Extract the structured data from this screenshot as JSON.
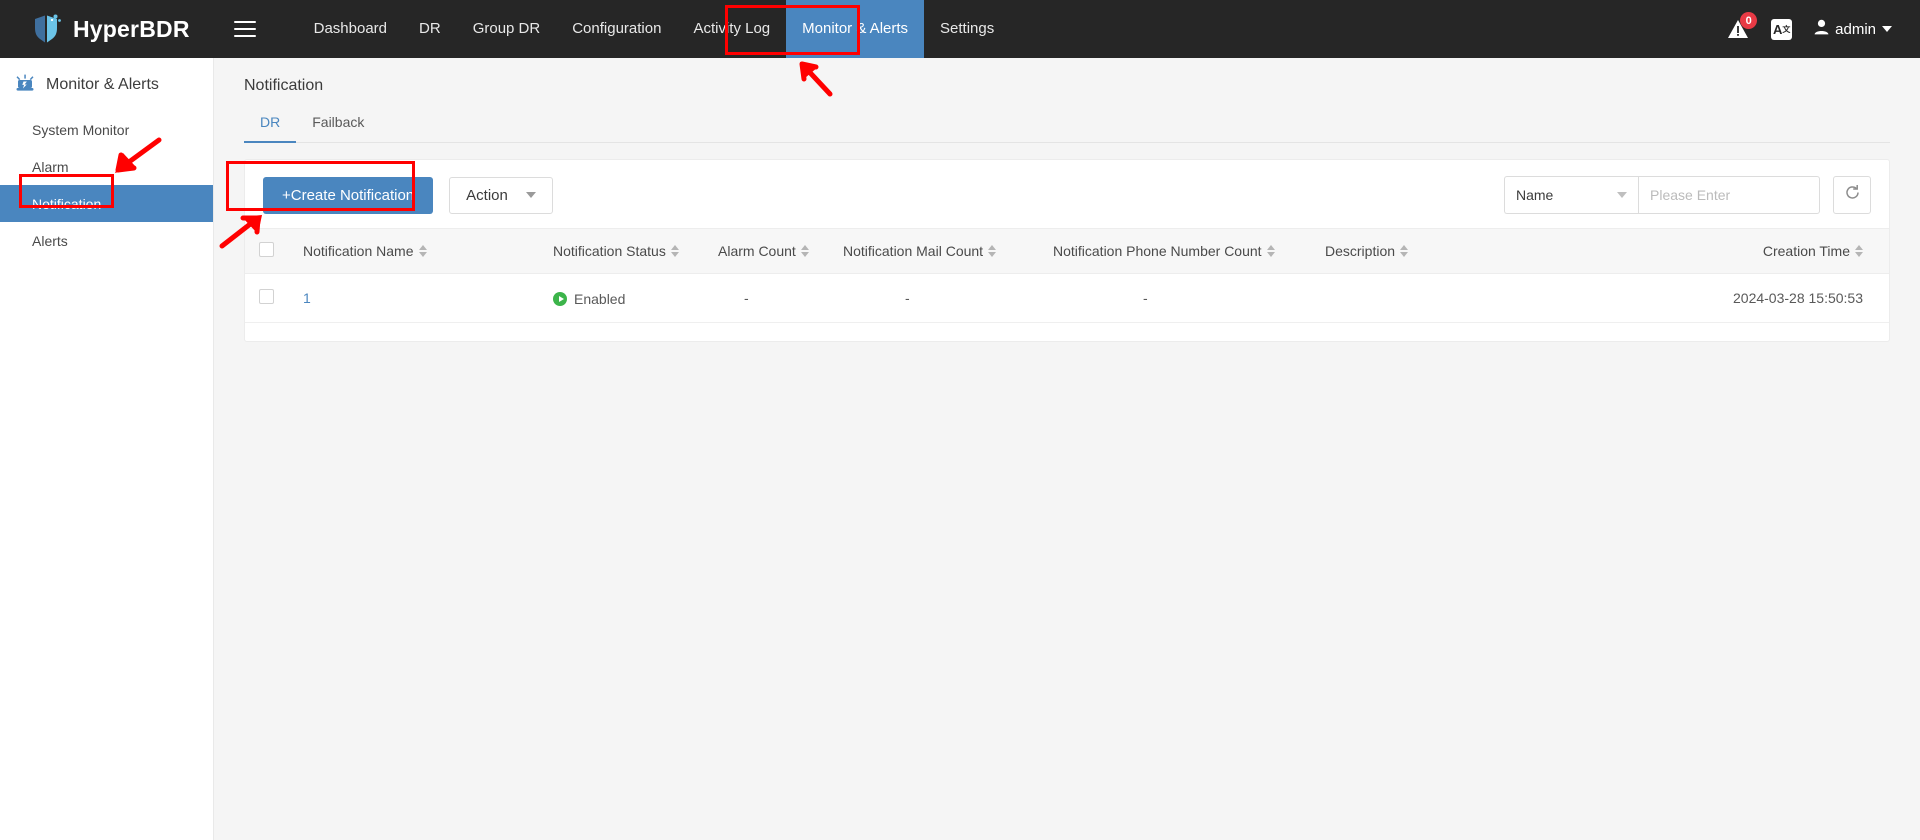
{
  "topbar": {
    "brand": "HyperBDR",
    "menu_icon": "hamburger-icon",
    "nav": [
      {
        "label": "Dashboard",
        "active": false
      },
      {
        "label": "DR",
        "active": false
      },
      {
        "label": "Group DR",
        "active": false
      },
      {
        "label": "Configuration",
        "active": false
      },
      {
        "label": "Activity Log",
        "active": false
      },
      {
        "label": "Monitor & Alerts",
        "active": true
      },
      {
        "label": "Settings",
        "active": false
      }
    ],
    "alarm_badge": "0",
    "lang_label": "A",
    "user_name": "admin"
  },
  "sidebar": {
    "section_title": "Monitor & Alerts",
    "items": [
      {
        "label": "System Monitor",
        "active": false
      },
      {
        "label": "Alarm",
        "active": false
      },
      {
        "label": "Notification",
        "active": true
      },
      {
        "label": "Alerts",
        "active": false
      }
    ]
  },
  "main": {
    "page_title": "Notification",
    "tabs": [
      {
        "label": "DR",
        "active": true
      },
      {
        "label": "Failback",
        "active": false
      }
    ],
    "toolbar": {
      "create_label": "+Create Notification",
      "action_label": "Action",
      "filter_field": "Name",
      "search_placeholder": "Please Enter",
      "search_value": "",
      "refresh_icon": "refresh-icon"
    },
    "table": {
      "columns": [
        {
          "label": "Notification Name",
          "sortable": true
        },
        {
          "label": "Notification Status",
          "sortable": true
        },
        {
          "label": "Alarm Count",
          "sortable": true
        },
        {
          "label": "Notification Mail Count",
          "sortable": true
        },
        {
          "label": "Notification Phone Number Count",
          "sortable": true
        },
        {
          "label": "Description",
          "sortable": true
        },
        {
          "label": "Creation Time",
          "sortable": true
        }
      ],
      "rows": [
        {
          "name": "1",
          "status": "Enabled",
          "alarm_count": "-",
          "mail_count": "-",
          "phone_count": "-",
          "description": "",
          "creation_time": "2024-03-28 15:50:53"
        }
      ]
    }
  },
  "colors": {
    "accent": "#4a86bf",
    "topbar_bg": "#262626",
    "annotation": "#ff0000",
    "status_green": "#3cb44a",
    "badge_red": "#e83a45"
  }
}
